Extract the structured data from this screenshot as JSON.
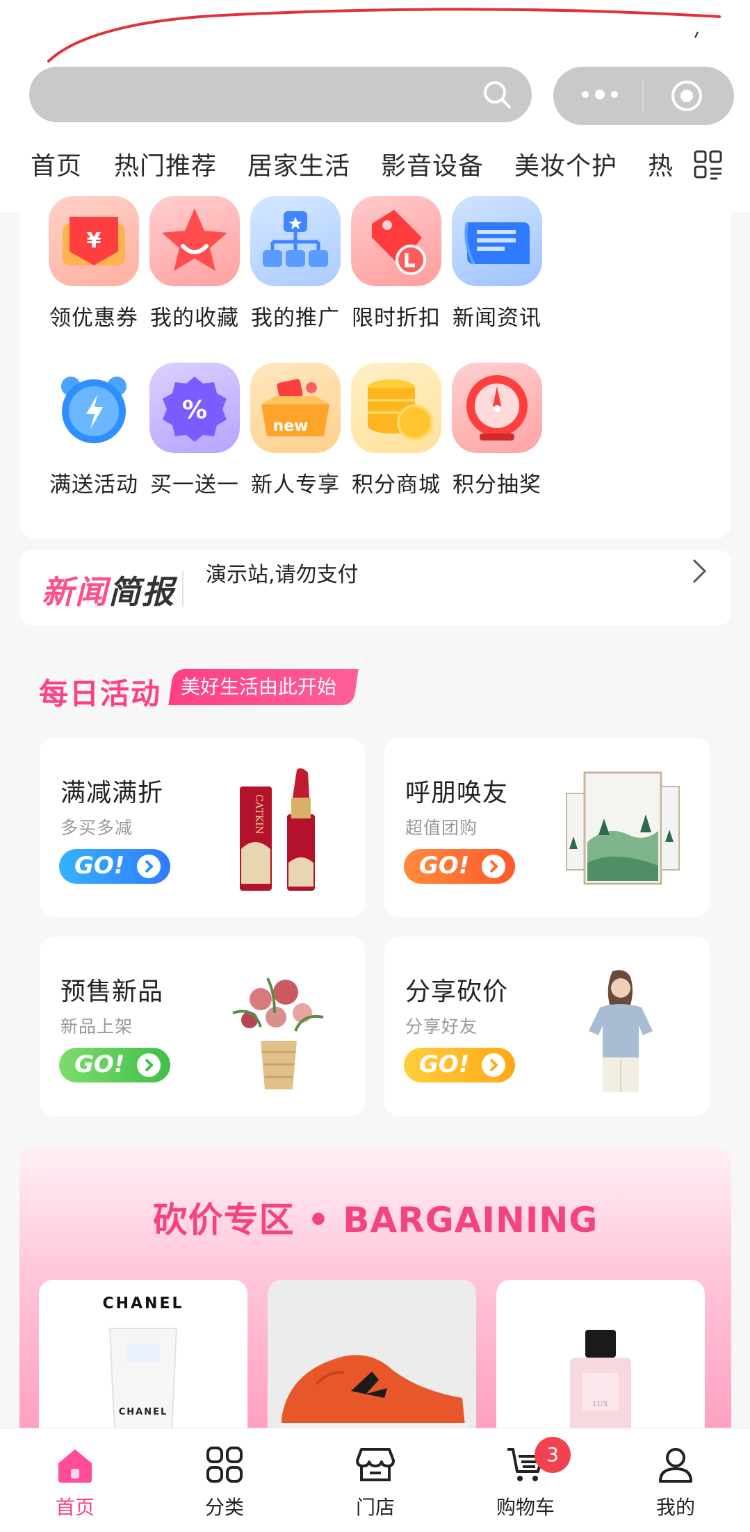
{
  "header": {
    "search_icon": "search-icon",
    "more_icon": "more-dots-icon",
    "target_icon": "target-icon"
  },
  "tabs": [
    "首页",
    "热门推荐",
    "居家生活",
    "影音设备",
    "美妆个护",
    "热"
  ],
  "grid_items": [
    {
      "label": "领优惠券",
      "icon": "coupon-icon",
      "color": "#ff5b5b"
    },
    {
      "label": "我的收藏",
      "icon": "star-icon",
      "color": "#ff6b6b"
    },
    {
      "label": "我的推广",
      "icon": "network-icon",
      "color": "#6aa8ff"
    },
    {
      "label": "限时折扣",
      "icon": "price-tag-icon",
      "color": "#ff5a5a"
    },
    {
      "label": "新闻资讯",
      "icon": "newspaper-icon",
      "color": "#4d8dff"
    },
    {
      "label": "满送活动",
      "icon": "alarm-clock-icon",
      "color": "#3b9bff"
    },
    {
      "label": "买一送一",
      "icon": "percent-badge-icon",
      "color": "#8a6bff"
    },
    {
      "label": "新人专享",
      "icon": "gift-box-icon",
      "color": "#ffb13b"
    },
    {
      "label": "积分商城",
      "icon": "coins-icon",
      "color": "#ffbf2b"
    },
    {
      "label": "积分抽奖",
      "icon": "lottery-wheel-icon",
      "color": "#ff4b4b"
    }
  ],
  "news": {
    "logo_a": "新闻",
    "logo_b": "简报",
    "text": "演示站,请勿支付"
  },
  "daily": {
    "title": "每日活动",
    "badge": "美好生活由此开始",
    "cards": [
      {
        "title": "满减满折",
        "subtitle": "多买多减",
        "go": "GO!",
        "color_from": "#2fa8ff",
        "color_to": "#2f7bff",
        "image": "lipstick-image"
      },
      {
        "title": "呼朋唤友",
        "subtitle": "超值团购",
        "go": "GO!",
        "color_from": "#ff8a3d",
        "color_to": "#ff5a2a",
        "image": "wall-art-image"
      },
      {
        "title": "预售新品",
        "subtitle": "新品上架",
        "go": "GO!",
        "color_from": "#79d96b",
        "color_to": "#3fbf4a",
        "image": "flower-vase-image"
      },
      {
        "title": "分享砍价",
        "subtitle": "分享好友",
        "go": "GO!",
        "color_from": "#ffcf3a",
        "color_to": "#ffa716",
        "image": "woman-tshirt-image"
      }
    ]
  },
  "bargain": {
    "title": "砍价专区 • BARGAINING",
    "products": [
      {
        "brand": "CHANEL",
        "brand_bottom": "CHANEL",
        "image": "cleanser-tube-image"
      },
      {
        "brand": "",
        "image": "sneaker-image"
      },
      {
        "brand": "",
        "image": "perfume-bottle-image"
      }
    ]
  },
  "bottom_nav": [
    {
      "label": "首页",
      "icon": "home-icon",
      "active": true
    },
    {
      "label": "分类",
      "icon": "category-grid-icon",
      "active": false
    },
    {
      "label": "门店",
      "icon": "store-icon",
      "active": false
    },
    {
      "label": "购物车",
      "icon": "cart-icon",
      "active": false,
      "badge": "3"
    },
    {
      "label": "我的",
      "icon": "profile-icon",
      "active": false
    }
  ]
}
